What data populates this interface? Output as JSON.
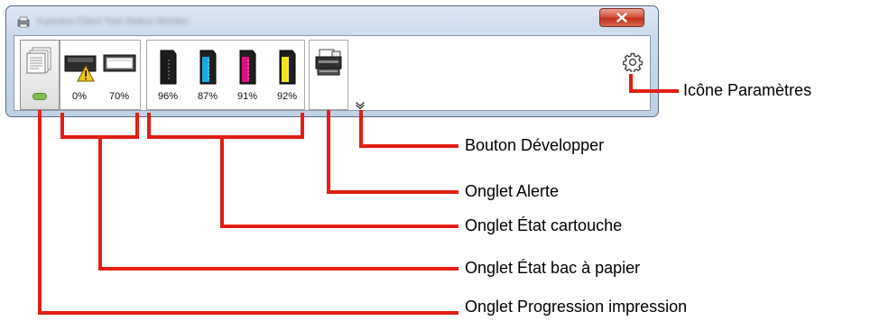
{
  "window": {
    "title": "Kyocera Client Tool Status Monitor",
    "close_icon": "close-icon",
    "app_icon": "printer-app-icon"
  },
  "tabs": {
    "print_progress": {
      "icon": "document-stack-icon",
      "indicator": "progress-pill-icon"
    },
    "paper_tray": {
      "trays": [
        {
          "icon": "paper-tray-warning-icon",
          "level": "0%"
        },
        {
          "icon": "paper-tray-icon",
          "level": "70%"
        }
      ]
    },
    "toner": {
      "cartridges": [
        {
          "color": "#1a1a1a",
          "level": "96%"
        },
        {
          "color": "#1fa7e2",
          "level": "87%"
        },
        {
          "color": "#d9127f",
          "level": "91%"
        },
        {
          "color": "#f2e51c",
          "level": "92%"
        }
      ]
    },
    "alert": {
      "icon": "printer-alert-icon"
    }
  },
  "expand_icon": "expand-chevron-icon",
  "settings_icon": "gear-icon",
  "callouts": {
    "settings": "Icône Paramètres",
    "expand": "Bouton Développer",
    "alert": "Onglet Alerte",
    "toner": "Onglet État cartouche",
    "paper": "Onglet État bac à papier",
    "progress": "Onglet Progression impression"
  },
  "colors": {
    "callout_line": "#e41e14"
  }
}
